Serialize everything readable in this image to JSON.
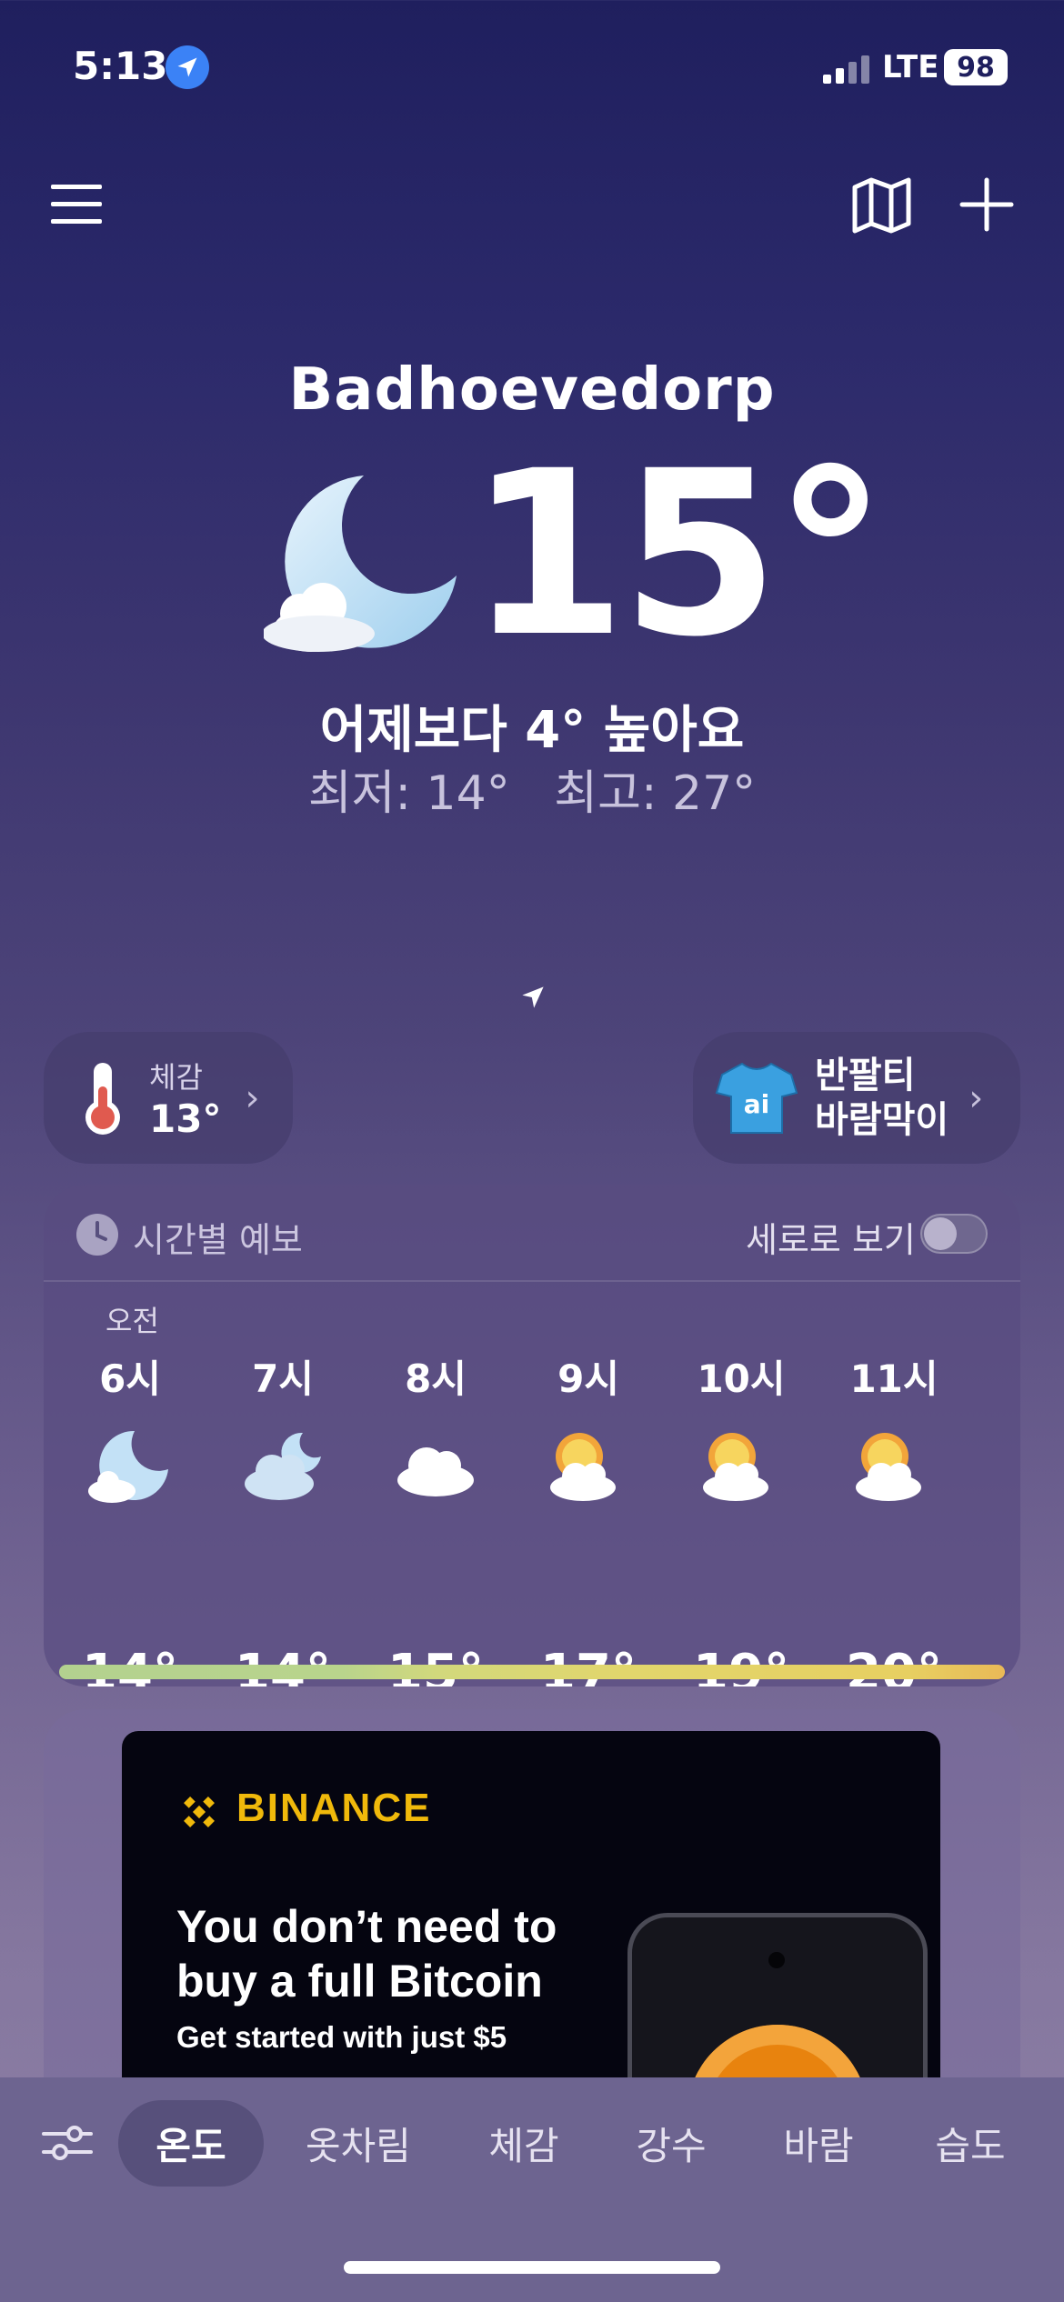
{
  "status_bar": {
    "time": "5:13",
    "network": "LTE",
    "battery": "98"
  },
  "location": {
    "city": "Badhoevedorp"
  },
  "current": {
    "temperature": "15°",
    "comparison": "어제보다 4° 높아요",
    "low": "최저: 14°",
    "high": "최고: 27°"
  },
  "feels_like": {
    "label": "체감",
    "value": "13°"
  },
  "outfit": {
    "line1": "반팔티",
    "line2": "바람막이",
    "badge": "ai"
  },
  "hourly": {
    "title": "시간별 예보",
    "vertical_view_label": "세로로 보기",
    "vertical_view_on": false,
    "period": "오전",
    "hours": [
      {
        "label": "6시",
        "temp": "14°",
        "icon": "moon-cloud-icon"
      },
      {
        "label": "7시",
        "temp": "14°",
        "icon": "cloud-moon-icon"
      },
      {
        "label": "8시",
        "temp": "15°",
        "icon": "cloud-icon"
      },
      {
        "label": "9시",
        "temp": "17°",
        "icon": "sun-cloud-icon"
      },
      {
        "label": "10시",
        "temp": "19°",
        "icon": "sun-cloud-icon"
      },
      {
        "label": "11시",
        "temp": "20°",
        "icon": "sun-cloud-icon"
      }
    ]
  },
  "ad": {
    "brand": "BINANCE",
    "headline_line1": "You don’t need to",
    "headline_line2": "buy a full Bitcoin",
    "subline": "Get started with just $5",
    "brand_color": "#f0b90b"
  },
  "tabs": [
    {
      "label": "온도",
      "active": true
    },
    {
      "label": "옷차림",
      "active": false
    },
    {
      "label": "체감",
      "active": false
    },
    {
      "label": "강수",
      "active": false
    },
    {
      "label": "바람",
      "active": false
    },
    {
      "label": "습도",
      "active": false
    }
  ]
}
